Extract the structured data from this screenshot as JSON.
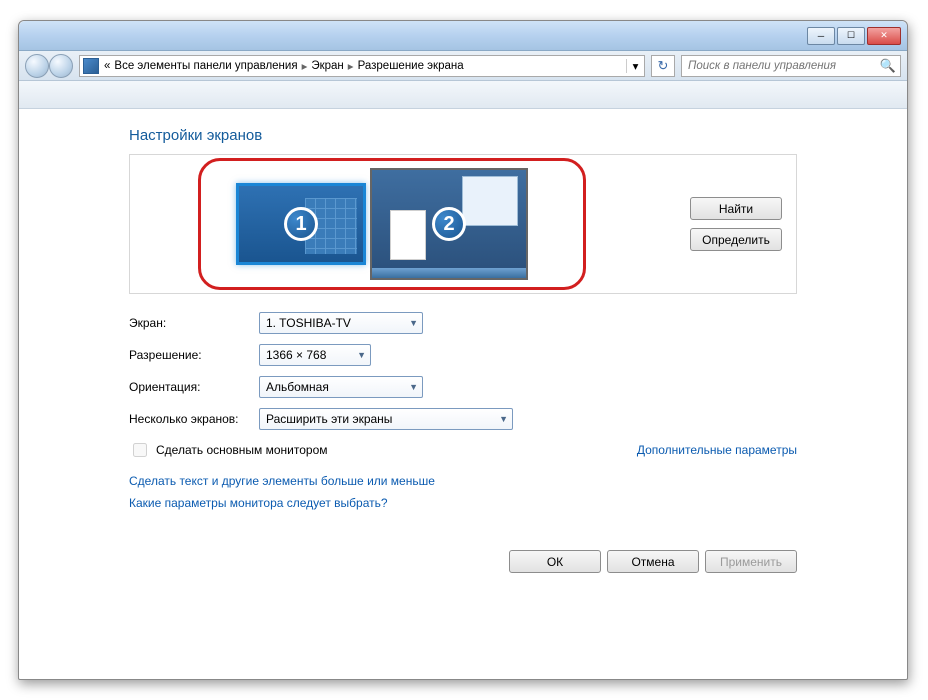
{
  "window": {
    "breadcrumb": {
      "prefix": "«",
      "items": [
        "Все элементы панели управления",
        "Экран",
        "Разрешение экрана"
      ]
    },
    "search_placeholder": "Поиск в панели управления"
  },
  "page": {
    "title": "Настройки экранов",
    "find_btn": "Найти",
    "detect_btn": "Определить",
    "monitors": [
      {
        "id": "1",
        "selected": true
      },
      {
        "id": "2",
        "selected": false
      }
    ],
    "labels": {
      "display": "Экран:",
      "resolution": "Разрешение:",
      "orientation": "Ориентация:",
      "multiple": "Несколько экранов:"
    },
    "display_value": "1. TOSHIBA-TV",
    "resolution_value": "1366 × 768",
    "orientation_value": "Альбомная",
    "multiple_value": "Расширить эти экраны",
    "make_primary_label": "Сделать основным монитором",
    "advanced_link": "Дополнительные параметры",
    "link1": "Сделать текст и другие элементы больше или меньше",
    "link2": "Какие параметры монитора следует выбрать?",
    "buttons": {
      "ok": "ОК",
      "cancel": "Отмена",
      "apply": "Применить"
    }
  }
}
